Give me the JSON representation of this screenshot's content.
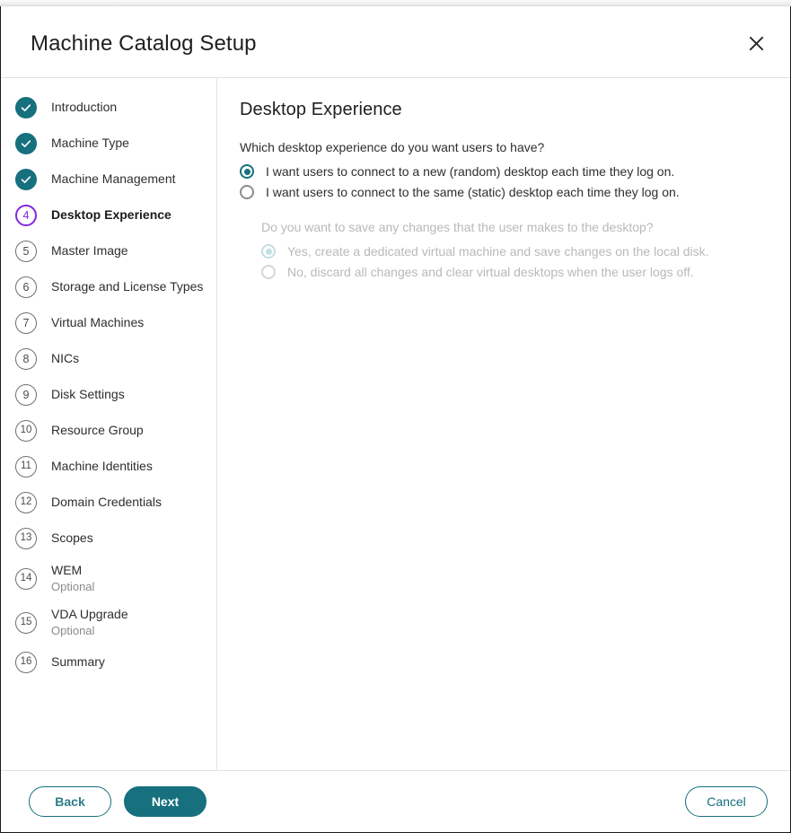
{
  "window": {
    "title": "Machine Catalog Setup",
    "close_icon": "close-icon"
  },
  "colors": {
    "teal": "#16707e",
    "active_purple": "#8426e0",
    "disabled_text": "#b9b9b9",
    "divider": "#e2e2e2"
  },
  "sidebar": {
    "steps": [
      {
        "number": "1",
        "label": "Introduction",
        "sub": "",
        "state": "done"
      },
      {
        "number": "2",
        "label": "Machine Type",
        "sub": "",
        "state": "done"
      },
      {
        "number": "3",
        "label": "Machine Management",
        "sub": "",
        "state": "done"
      },
      {
        "number": "4",
        "label": "Desktop Experience",
        "sub": "",
        "state": "current"
      },
      {
        "number": "5",
        "label": "Master Image",
        "sub": "",
        "state": "todo"
      },
      {
        "number": "6",
        "label": "Storage and License Types",
        "sub": "",
        "state": "todo"
      },
      {
        "number": "7",
        "label": "Virtual Machines",
        "sub": "",
        "state": "todo"
      },
      {
        "number": "8",
        "label": "NICs",
        "sub": "",
        "state": "todo"
      },
      {
        "number": "9",
        "label": "Disk Settings",
        "sub": "",
        "state": "todo"
      },
      {
        "number": "10",
        "label": "Resource Group",
        "sub": "",
        "state": "todo"
      },
      {
        "number": "11",
        "label": "Machine Identities",
        "sub": "",
        "state": "todo"
      },
      {
        "number": "12",
        "label": "Domain Credentials",
        "sub": "",
        "state": "todo"
      },
      {
        "number": "13",
        "label": "Scopes",
        "sub": "",
        "state": "todo"
      },
      {
        "number": "14",
        "label": "WEM",
        "sub": "Optional",
        "state": "todo"
      },
      {
        "number": "15",
        "label": "VDA Upgrade",
        "sub": "Optional",
        "state": "todo"
      },
      {
        "number": "16",
        "label": "Summary",
        "sub": "",
        "state": "todo"
      }
    ]
  },
  "main": {
    "title": "Desktop Experience",
    "question": "Which desktop experience do you want users to have?",
    "options": [
      {
        "label": "I want users to connect to a new (random) desktop each time they log on.",
        "checked": true,
        "disabled": false
      },
      {
        "label": "I want users to connect to the same (static) desktop each time they log on.",
        "checked": false,
        "disabled": false
      }
    ],
    "sub_question": "Do you want to save any changes that the user makes to the desktop?",
    "sub_options": [
      {
        "label": "Yes, create a dedicated virtual machine and save changes on the local disk.",
        "checked": true,
        "disabled": true
      },
      {
        "label": "No, discard all changes and clear virtual desktops when the user logs off.",
        "checked": false,
        "disabled": true
      }
    ]
  },
  "footer": {
    "back_label": "Back",
    "next_label": "Next",
    "cancel_label": "Cancel"
  }
}
